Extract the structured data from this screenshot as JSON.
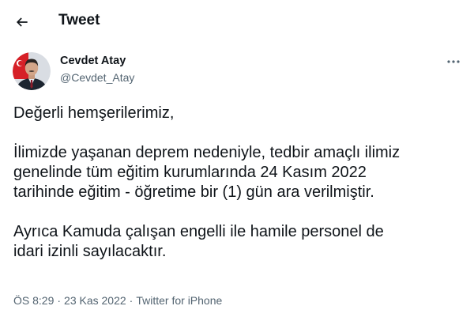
{
  "header": {
    "back_icon": "arrow-left-icon",
    "title": "Tweet"
  },
  "author": {
    "display_name": "Cevdet Atay",
    "handle": "@Cevdet_Atay",
    "avatar_icon": "profile-photo"
  },
  "more_icon": "more-horizontal-icon",
  "tweet": {
    "paragraphs": [
      "Değerli hemşerilerimiz,",
      "İlimizde yaşanan deprem nedeniyle, tedbir amaçlı ilimiz\ngenelinde tüm eğitim kurumlarında 24 Kasım 2022\ntarihinde eğitim - öğretime bir (1) gün ara verilmiştir.",
      "Ayrıca Kamuda çalışan engelli ile hamile personel de\nidari izinli sayılacaktır."
    ]
  },
  "meta": {
    "time": "ÖS 8:29",
    "separator": "·",
    "date": "23 Kas 2022",
    "source": "Twitter for iPhone"
  },
  "colors": {
    "text": "#0f1419",
    "secondary": "#536471",
    "background": "#ffffff"
  }
}
